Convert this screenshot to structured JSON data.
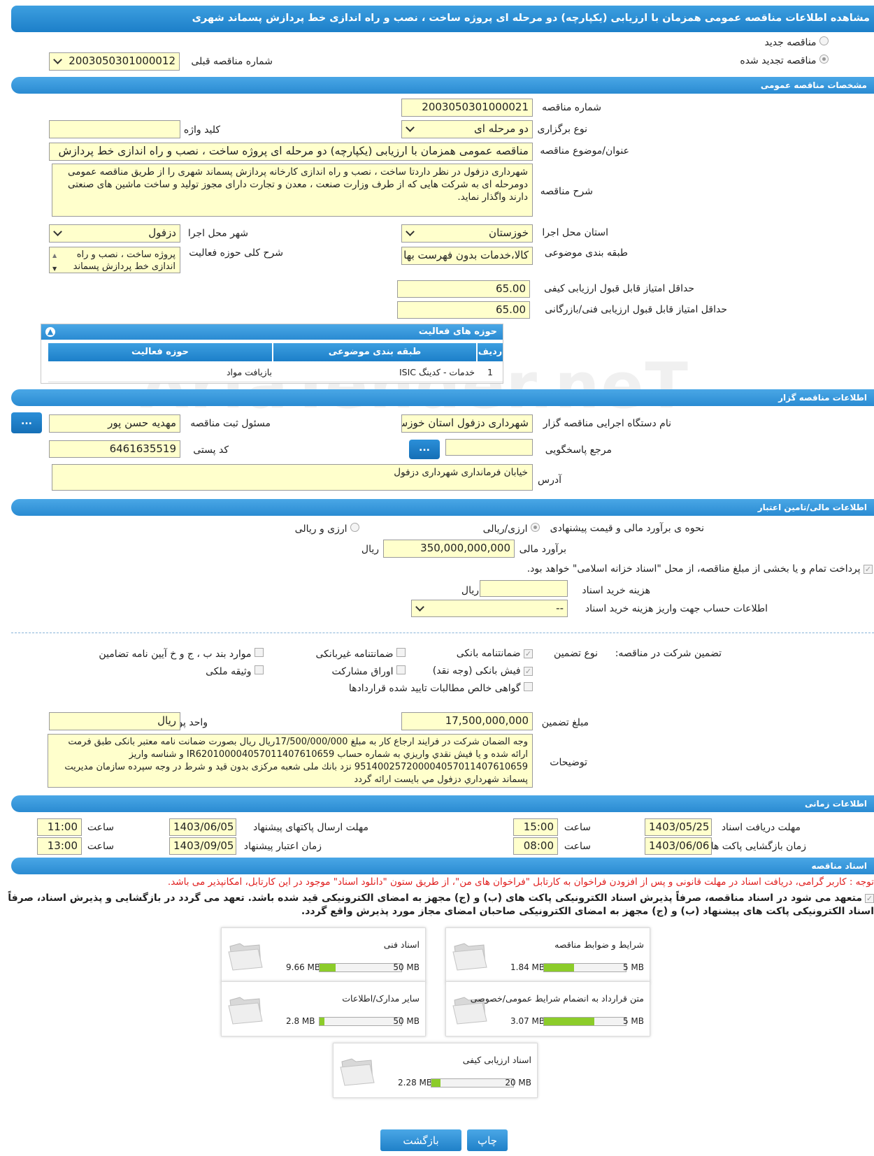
{
  "page_title": "مشاهده اطلاعات مناقصه عمومی همزمان با ارزیابی (یکپارچه) دو مرحله ای پروژه ساخت ، نصب و راه اندازی خط پردازش پسماند شهری",
  "tender_type": {
    "new_label": "مناقصه جدید",
    "renewed_label": "مناقصه تجدید شده",
    "prev_number_label": "شماره مناقصه قبلی",
    "prev_number": "2003050301000012"
  },
  "general": {
    "section_title": "مشخصات مناقصه عمومی",
    "number_label": "شماره مناقصه",
    "number": "2003050301000021",
    "holding_type_label": "نوع برگزاری",
    "holding_type": "دو مرحله ای",
    "keyword_label": "کلید واژه",
    "keyword": "",
    "subject_label": "عنوان/موضوع مناقصه",
    "subject": "مناقصه عمومی همزمان با ارزیابی (یکپارچه) دو مرحله ای پروژه ساخت ، نصب و راه اندازی خط پردازش",
    "description_label": "شرح مناقصه",
    "description": "شهرداری دزفول در نظر داردتا ساخت ، نصب و راه اندازی کارخانه پردازش پسماند شهری را از طریق مناقصه عمومی دومرحله ای به شرکت هایی که از طرف وزارت صنعت ، معدن و تجارت دارای مجوز تولید و ساخت ماشین های صنعتی دارند واگذار نماید.",
    "province_label": "استان محل اجرا",
    "province": "خوزستان",
    "city_label": "شهر محل اجرا",
    "city": "دزفول",
    "category_label": "طبقه بندی موضوعی",
    "category": "کالا،خدمات بدون فهرست بها",
    "activity_desc_label": "شرح کلی حوزه فعالیت",
    "activity_desc": "پروژه ساخت ، نصب و راه اندازی خط پردازش پسماند",
    "min_quality_label": "حداقل امتیاز قابل قبول ارزیابی کیفی",
    "min_quality": "65.00",
    "min_tech_label": "حداقل امتیاز قابل قبول ارزیابی فنی/بازرگانی",
    "min_tech": "65.00"
  },
  "activity_panel": {
    "title": "حوزه های فعالیت",
    "columns": [
      "ردیف",
      "طبقه بندی موضوعی",
      "حوزه فعالیت"
    ],
    "rows": [
      {
        "index": "1",
        "category": "خدمات - کدینگ ISIC",
        "field": "بازیافت مواد"
      }
    ]
  },
  "organizer": {
    "section_title": "اطلاعات مناقصه گزار",
    "org_label": "نام دستگاه اجرایی مناقصه گزار",
    "org": "شهرداری دزفول استان خوزستان",
    "registrar_label": "مسئول ثبت مناقصه",
    "registrar": "مهدیه حسن پور",
    "ref_label": "مرجع پاسخگویی",
    "ref": "",
    "postal_label": "کد پستی",
    "postal": "6461635519",
    "address_label": "آدرس",
    "address": "خیابان فرمانداری شهرداری دزفول",
    "more_button": "..."
  },
  "finance": {
    "section_title": "اطلاعات مالی/تامین اعتبار",
    "method_label": "نحوه ی برآورد مالی و قیمت پیشنهادی",
    "opt_currency_rial": "ارزی/ریالی",
    "opt_currency_and_rial": "ارزی و ریالی",
    "estimate_label": "برآورد مالی",
    "estimate": "350,000,000,000",
    "rial": "ریال",
    "treasury_note": "پرداخت تمام و یا بخشی از مبلغ مناقصه، از محل \"اسناد خزانه اسلامی\" خواهد بود.",
    "doc_fee_label": "هزینه خرید اسناد",
    "doc_fee": "",
    "account_label": "اطلاعات حساب جهت واریز هزینه خرید اسناد",
    "account": "--"
  },
  "guarantee": {
    "title_label": "تضمین شرکت در مناقصه:",
    "type_label": "نوع تضمین",
    "options": [
      {
        "label": "ضمانتنامه بانکی",
        "checked": true
      },
      {
        "label": "ضمانتنامه غیربانکی",
        "checked": false
      },
      {
        "label": "موارد بند ب ، ج و خ آیین نامه تضامین",
        "checked": false
      },
      {
        "label": "فیش بانکی (وجه نقد)",
        "checked": true
      },
      {
        "label": "اوراق مشارکت",
        "checked": false
      },
      {
        "label": "وثیقه ملکی",
        "checked": false
      },
      {
        "label": "گواهی خالص مطالبات تایید شده قراردادها",
        "checked": false
      }
    ],
    "amount_label": "مبلغ تضمین",
    "amount": "17,500,000,000",
    "unit_label": "واحد پول",
    "unit": "ریال",
    "notes_label": "توضیحات",
    "notes": "وجه الضمان شرکت در فرایند ارجاع کار به  مبلغ  17/500/000/000ریال ریال بصورت ضمانت نامه معتبر بانکی طبق فرمت ارائه شده و یا  فیش نقدي واريزي  به شماره حساب  IR620100004057011407610659 و شناسه واریز 951400257200004057011407610659 نزد بانك ملی شعبه مرکزی  بدون قيد و شرط در وجه سپرده سازمان مديريت پسماند شهرداري دزفول مي بايست ارائه گردد"
  },
  "timing": {
    "section_title": "اطلاعات زمانی",
    "receive_label": "مهلت دریافت اسناد",
    "receive_date": "1403/05/25",
    "receive_time": "15:00",
    "send_label": "مهلت ارسال پاکتهای پیشنهاد",
    "send_date": "1403/06/05",
    "send_time": "11:00",
    "open_label": "زمان بازگشایی پاکت ها",
    "open_date": "1403/06/06",
    "open_time": "08:00",
    "validity_label": "زمان اعتبار پیشنهاد",
    "validity_date": "1403/09/05",
    "validity_time": "13:00",
    "time_label": "ساعت"
  },
  "documents": {
    "section_title": "اسناد مناقصه",
    "notice": "توجه : کاربر گرامی، دریافت اسناد در مهلت قانونی و پس از افزودن فراخوان به کارتابل \"فراخوان های من\"، از طریق ستون \"دانلود اسناد\" موجود در این کارتابل، امکانپذیر می باشد.",
    "commitment": "متعهد می شود در اسناد مناقصه، صرفاً پذیرش اسناد الکترونیکی پاکت های (ب) و (ج) مجهز به امضای الکترونیکی قید شده باشد. تعهد می گردد در بازگشایی و پذیرش اسناد، صرفاً اسناد الکترونیکی پاکت های پیشنهاد (ب) و (ج) مجهز به امضای الکترونیکی صاحبان امضای مجاز مورد پذیرش واقع گردد.",
    "files": [
      {
        "title": "شرایط و ضوابط مناقصه",
        "used": "1.84 MB",
        "max": "5 MB",
        "ratio": 0.368
      },
      {
        "title": "اسناد فنی",
        "used": "9.66 MB",
        "max": "50 MB",
        "ratio": 0.193
      },
      {
        "title": "متن قرارداد به انضمام شرایط عمومی/خصوصی",
        "used": "3.07 MB",
        "max": "5 MB",
        "ratio": 0.614
      },
      {
        "title": "سایر مدارک/اطلاعات",
        "used": "2.8 MB",
        "max": "50 MB",
        "ratio": 0.056
      },
      {
        "title": "اسناد ارزیابی کیفی",
        "used": "2.28 MB",
        "max": "20 MB",
        "ratio": 0.114
      }
    ]
  },
  "buttons": {
    "print": "چاپ",
    "back": "بازگشت"
  },
  "watermark": "AriaTender.neT",
  "colors": {
    "header_blue": "#1c7fc9",
    "field_yellow": "#ffffcc",
    "bar_green": "#8ccc2a",
    "notice_red": "#e02020"
  },
  "icons": [
    "folder-icon",
    "chevron-down-icon",
    "collapse-icon"
  ]
}
